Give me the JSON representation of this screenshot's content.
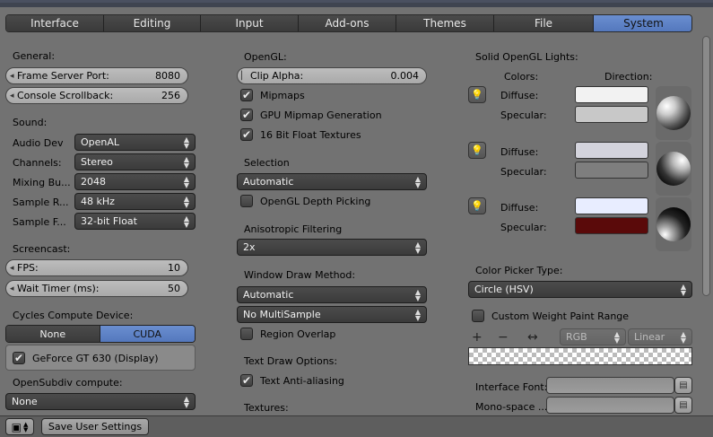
{
  "tabs": [
    {
      "label": "Interface",
      "active": false
    },
    {
      "label": "Editing",
      "active": false
    },
    {
      "label": "Input",
      "active": false
    },
    {
      "label": "Add-ons",
      "active": false
    },
    {
      "label": "Themes",
      "active": false
    },
    {
      "label": "File",
      "active": false
    },
    {
      "label": "System",
      "active": true
    }
  ],
  "left": {
    "general_heading": "General:",
    "frame_server_port": {
      "label": "Frame Server Port:",
      "value": "8080"
    },
    "console_scrollback": {
      "label": "Console Scrollback:",
      "value": "256"
    },
    "sound_heading": "Sound:",
    "audio_dev": {
      "label": "Audio Dev",
      "value": "OpenAL"
    },
    "channels": {
      "label": "Channels:",
      "value": "Stereo"
    },
    "mixing_buffer": {
      "label": "Mixing Bu...",
      "value": "2048"
    },
    "sample_rate": {
      "label": "Sample R...",
      "value": "48 kHz"
    },
    "sample_format": {
      "label": "Sample F...",
      "value": "32-bit Float"
    },
    "screencast_heading": "Screencast:",
    "fps": {
      "label": "FPS:",
      "value": "10"
    },
    "wait_timer": {
      "label": "Wait Timer (ms):",
      "value": "50"
    },
    "cycles_heading": "Cycles Compute Device:",
    "cycles_none": "None",
    "cycles_cuda": "CUDA",
    "gpu_device": "GeForce GT 630 (Display)",
    "opensubdiv_heading": "OpenSubdiv compute:",
    "opensubdiv_value": "None"
  },
  "middle": {
    "opengl_heading": "OpenGL:",
    "clip_alpha": {
      "label": "Clip Alpha:",
      "value": "0.004"
    },
    "mipmaps": "Mipmaps",
    "gpu_mipmap": "GPU Mipmap Generation",
    "float_textures": "16 Bit Float Textures",
    "selection_heading": "Selection",
    "selection_value": "Automatic",
    "depth_picking": "OpenGL Depth Picking",
    "aniso_heading": "Anisotropic Filtering",
    "aniso_value": "2x",
    "window_draw_heading": "Window Draw Method:",
    "window_draw_value": "Automatic",
    "multisample_value": "No MultiSample",
    "region_overlap": "Region Overlap",
    "text_draw_heading": "Text Draw Options:",
    "text_antialias": "Text Anti-aliasing",
    "textures_heading": "Textures:"
  },
  "right": {
    "lights_heading": "Solid OpenGL Lights:",
    "colors_heading": "Colors:",
    "direction_heading": "Direction:",
    "diffuse": "Diffuse:",
    "specular": "Specular:",
    "light1": {
      "diffuse": "#f2f2f2",
      "specular": "#c8c8c8"
    },
    "light2": {
      "diffuse": "#d3d3dc",
      "specular": "#7e7e7e"
    },
    "light3": {
      "diffuse": "#e8edff",
      "specular": "#5a0a0a"
    },
    "color_picker_heading": "Color Picker Type:",
    "color_picker_value": "Circle (HSV)",
    "custom_weight": "Custom Weight Paint Range",
    "ramp_mode": "RGB",
    "ramp_interp": "Linear",
    "interface_font": "Interface Font:",
    "monospace_font": "Mono-space ..."
  },
  "bottom": {
    "save_button": "Save User Settings"
  },
  "colors": {
    "accent": "#5a7fc4",
    "background": "#727272"
  }
}
